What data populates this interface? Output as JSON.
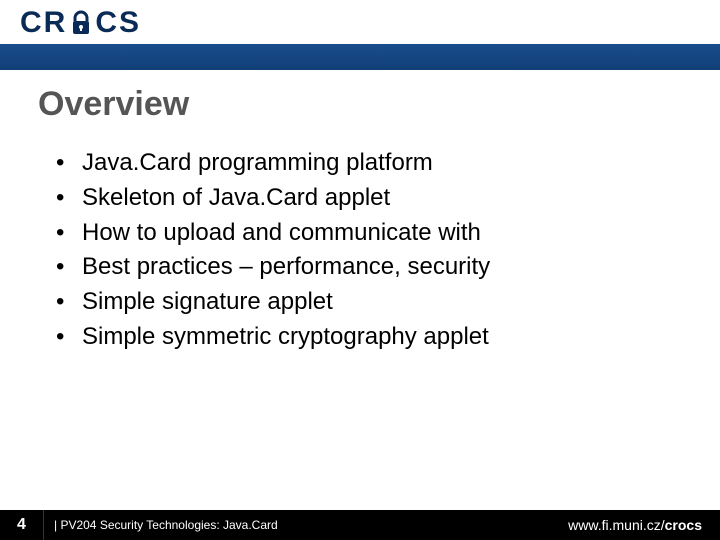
{
  "header": {
    "logo_left": "CR",
    "logo_right": "CS",
    "lock_icon_name": "lock-icon"
  },
  "title": "Overview",
  "bullets": [
    "Java.Card programming platform",
    "Skeleton of Java.Card applet",
    "How to upload and communicate with",
    "Best practices – performance, security",
    "Simple signature applet",
    "Simple symmetric cryptography applet"
  ],
  "footer": {
    "page_number": "4",
    "course_text": "| PV204 Security Technologies: Java.Card",
    "url_plain": "www.fi.muni.cz/",
    "url_bold": "crocs"
  },
  "colors": {
    "navy": "#113e76",
    "title_grey": "#555555"
  }
}
